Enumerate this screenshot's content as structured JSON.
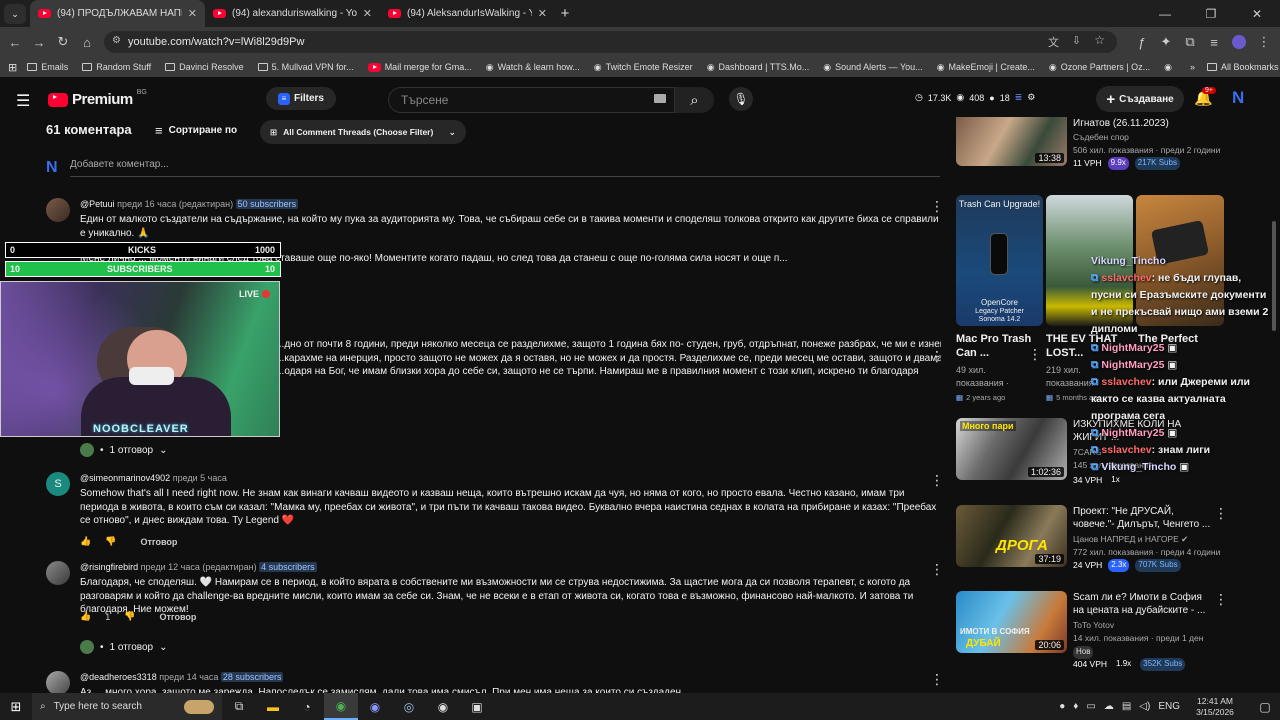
{
  "browser": {
    "tabs": [
      {
        "title": "(94) ПРОДЪЛЖАВАМ НАПРЕД...",
        "active": true
      },
      {
        "title": "(94) alexanduriswalking - YouTu...",
        "active": false
      },
      {
        "title": "(94) AleksandurIsWalking - You...",
        "active": false
      }
    ],
    "url": "youtube.com/watch?v=lWi8l29d9Pw",
    "bookmarks": [
      "Emails",
      "Random Stuff",
      "Davinci Resolve",
      "5. Mullvad VPN for...",
      "Mail merge for Gma...",
      "Watch & learn how...",
      "Twitch Emote Resizer",
      "Dashboard | TTS.Mo...",
      "Sound Alerts — You...",
      "MakeEmoji | Create...",
      "Ozone Partners | Oz..."
    ],
    "all_bookmarks": "All Bookmarks"
  },
  "youtube": {
    "logo": "Premium",
    "region": "BG",
    "filters_label": "Filters",
    "search_placeholder": "Търсене",
    "stat1": "17.3K",
    "stat2": "408",
    "stat3": "18",
    "create_label": "Създаване",
    "notif_count": "9+"
  },
  "comments_header": {
    "count": "61 коментара",
    "sort": "Сортиране по",
    "filter": "All Comment Threads (Choose Filter)",
    "add_placeholder": "Добавете коментар..."
  },
  "comments": [
    {
      "author": "@Petuui",
      "time": "преди 16 часа (редактиран)",
      "subs": "50 subscribers",
      "text": "Един от малкото създатели на съдържание, на който му пука за аудиторията му. Това, че събираш себе си в такива моменти и споделяш толкова открито как другите биха се справили е уникално. 🙏",
      "text2": "Мене лично ... моменти винаги след това ставаше още по-яко! Моментите когато падаш, но след това да станеш с още по-голяма сила носят и още п..."
    },
    {
      "text": "...дно от почти 8 години, преди няколко месеца се разделихме, защото 1 година бях по- студен, груб, отдръпнат, понеже разбрах, че ми е изневерила.",
      "text2": "...караxме на инерция, просто защото не можех да я оставя, но не можех и да простя. Разделихме се, преди месец ме остави, защото и двамата не се",
      "text3": "...одаря на Бог, че имам близки хора до себе си, защото не се търпи. Намираш ме в правилния момент с този клип, искрено ти благодаря",
      "replies": "1 отговор"
    },
    {
      "author": "@simeonmarinov4902",
      "time": "преди 5 часа",
      "text": "Somehow that's all I need right now. Не знам как винаги качваш видеото и казваш неща, които вътрешно искам да чуя, но няма от кого, но просто евала. Честно казано, имам три периода в живота, в които съм си казал: \"Мамка му, преебах си живота\", и три пъти ти качваш такова видео. Буквално вчера наистина седнах в колата на прибиране и казах: \"Преебах се отново\", и днес виждам това. Ty Legend ❤️",
      "reply_label": "Отговор"
    },
    {
      "author": "@risingfirebird",
      "time": "преди 12 часа (редактиран)",
      "subs": "4 subscribers",
      "text": "Благодаря, че споделяш. 🤍 Намирам се в период, в който вярата в собствените ми възможности ми се струва недостижима. За щастие мога да си позволя терапевт, с когото да разговарям и който да challenge-ва вредните мисли, които имам за себе си. Знам, че не всеки е в етап от живота си, когато това е възможно, финансово най-малкото. И затова ти благодаря. Ние можем!",
      "likes": "1",
      "reply_label": "Отговор",
      "replies": "1 отговор"
    },
    {
      "author": "@deadheroes3318",
      "time": "преди 14 часа",
      "subs": "28 subscribers",
      "text": "Аз ... много хора, защото ме зарежда. Напоследък се замислям, дали това има смисъл. При мен има неща за които си създаден ..."
    }
  ],
  "overlay": {
    "kicks_label": "KICKS",
    "kicks_min": "0",
    "kicks_max": "1000",
    "subs_label": "SUBSCRIBERS",
    "subs_left": "10",
    "subs_right": "10",
    "live": "LIVE",
    "cam_name": "NOOBCLEAVER"
  },
  "chat": [
    {
      "user": "Vikung_Tincho",
      "msg": ""
    },
    {
      "user": "sslavchev",
      "msg": ": не бъди глупав, пусни си Еразъмските документи и не прекъсвай нищо ами вземи 2 дипломи"
    },
    {
      "user": "NightMary25",
      "msg": ""
    },
    {
      "user": "NightMary25",
      "msg": ""
    },
    {
      "user": "sslavchev",
      "msg": ": или Джереми или както се казва актуалната програма сега"
    },
    {
      "user": "NightMary25",
      "msg": ""
    },
    {
      "user": "sslavchev",
      "msg": ": знам лиги"
    },
    {
      "user": "Vikung_Tincho",
      "msg": ""
    }
  ],
  "sidebar": [
    {
      "title": "Игнатов (26.11.2023)",
      "channel": "Съдебен спор",
      "meta": "506 хил. показвания · преди 2 години",
      "duration": "13:38",
      "vph": "11 VPH",
      "mult": "9.9x",
      "subs": "217K Subs"
    },
    {
      "title": "Mac Pro Trash Can ...",
      "meta1": "49 хил.",
      "meta2": "показвания ·",
      "ago": "2 years ago",
      "thumb_top": "Trash Can Upgrade!",
      "thumb_b1": "OpenCore",
      "thumb_b2": "Legacy Patcher",
      "thumb_b3": "Sonoma 14.2"
    },
    {
      "title": "THE EV THAT LOST...",
      "meta1": "219 хил.",
      "meta2": "показвания ·",
      "ago": "5 months ago"
    },
    {
      "title": "The Perfect Accessory...",
      "meta1": "",
      "meta2": "показвания ·"
    },
    {
      "title": "ИЗКУПИХМЕ КОЛИ НА ЖИГИТ ...",
      "channel": "7CARS",
      "meta": "145 хил. показвания",
      "duration": "1:02:36",
      "thumb_tag": "Много пари",
      "vph": "34 VPH",
      "mult": "1x"
    },
    {
      "title": "Проект: \"Не ДРУСАЙ, човече.\"- Дилърът, Ченгето ...",
      "channel": "Цанов НАПРЕД и НАГОРЕ",
      "meta": "772 хил. показвания · преди 4 години",
      "duration": "37:19",
      "thumb_text": "ДРОГА",
      "vph": "24 VPH",
      "mult": "2.3x",
      "subs": "707K Subs"
    },
    {
      "title": "Scam ли е? Имоти в София на цената на дубайските - ...",
      "channel": "ToTo Yotov",
      "meta": "14 хил. показвания · преди 1 ден",
      "duration": "20:06",
      "thumb_text1": "ИМОТИ В СОФИЯ",
      "thumb_text2": "ДУБАЙ",
      "new": "Нов",
      "vph": "404 VPH",
      "mult": "1.9x",
      "subs": "352K Subs"
    }
  ],
  "taskbar": {
    "search_placeholder": "Type here to search",
    "lang": "ENG",
    "time": "12:41 AM",
    "date": "3/15/2026"
  }
}
